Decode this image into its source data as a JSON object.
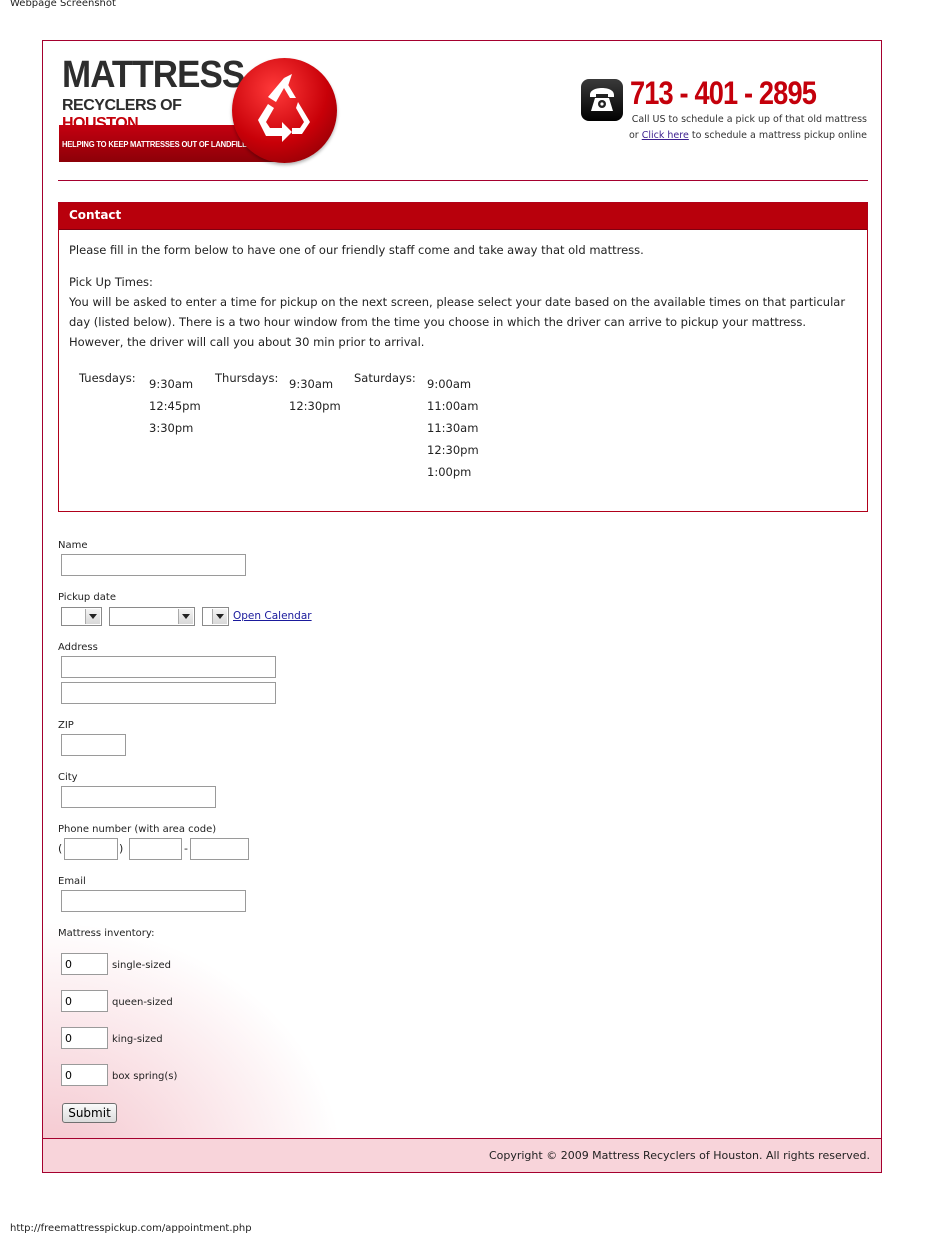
{
  "capture": {
    "caption": "Webpage Screenshot",
    "url": "http://freemattresspickup.com/appointment.php"
  },
  "header": {
    "logo_line1": "MATTRESS",
    "logo_line2_a": "RECYCLERS OF",
    "logo_line2_b": "HOUSTON",
    "logo_tagline": "HELPING TO KEEP MATTRESSES OUT OF LANDFILLS",
    "logo_icon": "recycle-icon",
    "phone_icon": "telephone-icon",
    "phone_number": "713 - 401 - 2895",
    "call_line": "Call US to schedule a pick up of that old mattress",
    "online_prefix": "or",
    "online_link": "Click here",
    "online_suffix": "to schedule a mattress pickup online"
  },
  "contact": {
    "title": "Contact",
    "intro": "Please fill in the form below to have one of our friendly staff come and take away that old mattress.",
    "pickup_heading": "Pick Up Times:",
    "pickup_text": "You will be asked to enter a time for pickup on the next screen, please select your date based on the available times on that particular day (listed below). There is a two hour window from the time you choose in which the driver can arrive to pickup your mattress. However, the driver will call you about 30 min prior to arrival.",
    "schedule": [
      {
        "day": "Tuesdays:",
        "times": [
          "9:30am",
          "12:45pm",
          "3:30pm"
        ]
      },
      {
        "day": "Thursdays:",
        "times": [
          "9:30am",
          "12:30pm"
        ]
      },
      {
        "day": "Saturdays:",
        "times": [
          "9:00am",
          "11:00am",
          "11:30am",
          "12:30pm",
          "1:00pm"
        ]
      }
    ]
  },
  "form": {
    "name_label": "Name",
    "name_value": "",
    "pickup_label": "Pickup date",
    "day_select_value": "",
    "month_select_value": "",
    "year_select_value": "",
    "calendar_link": "Open Calendar",
    "address_label": "Address",
    "address1_value": "",
    "address2_value": "",
    "zip_label": "ZIP",
    "zip_value": "",
    "city_label": "City",
    "city_value": "",
    "phone_label": "Phone number (with area code)",
    "phone_open_paren": "(",
    "phone_close_paren": ")",
    "phone_dash": "-",
    "phone_area_value": "",
    "phone_prefix_value": "",
    "phone_line_value": "",
    "email_label": "Email",
    "email_value": "",
    "inventory_label": "Mattress inventory:",
    "inventory": [
      {
        "value": "0",
        "label": "single-sized"
      },
      {
        "value": "0",
        "label": "queen-sized"
      },
      {
        "value": "0",
        "label": "king-sized"
      },
      {
        "value": "0",
        "label": "box spring(s)"
      }
    ],
    "submit_label": "Submit"
  },
  "footer": {
    "copyright": "Copyright © 2009 Mattress Recyclers of Houston. All rights reserved."
  },
  "colors": {
    "brand_red": "#b8000c",
    "phone_red": "#c4000b",
    "frame_border": "#a5002e",
    "footer_bg": "#f8d4da"
  }
}
